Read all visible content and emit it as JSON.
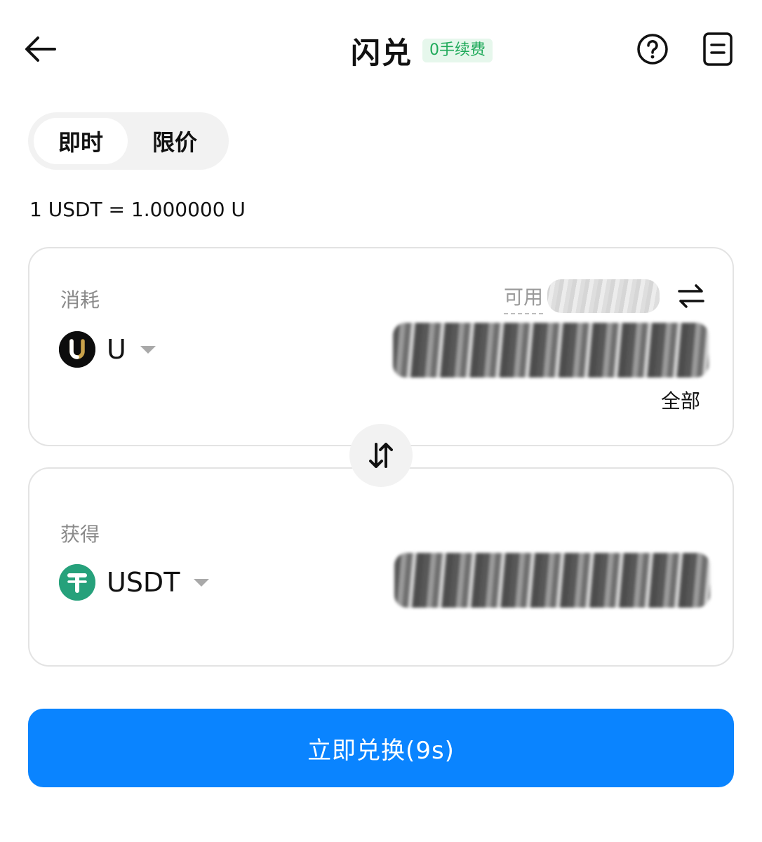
{
  "header": {
    "title": "闪兑",
    "fee_badge": "0手续费",
    "icons": {
      "back": "arrow-left-icon",
      "help": "question-circle-icon",
      "orders": "order-list-icon"
    }
  },
  "mode_tabs": [
    {
      "label": "即时",
      "active": true
    },
    {
      "label": "限价",
      "active": false
    }
  ],
  "rate_text": "1 USDT = 1.000000 U",
  "pay_card": {
    "label": "消耗",
    "available_label": "可用",
    "token": {
      "symbol": "U",
      "icon_letter": "U"
    },
    "max_label": "全部"
  },
  "receive_card": {
    "label": "获得",
    "token": {
      "symbol": "USDT",
      "icon_letter": "₮"
    }
  },
  "action_button": {
    "label": "立即兑换(9s)"
  },
  "colors": {
    "primary": "#0a84ff",
    "fee_badge_bg": "#e6f7ec",
    "fee_badge_text": "#1faa5a",
    "usdt_green": "#26a17b",
    "u_gold": "#c9a24a"
  }
}
